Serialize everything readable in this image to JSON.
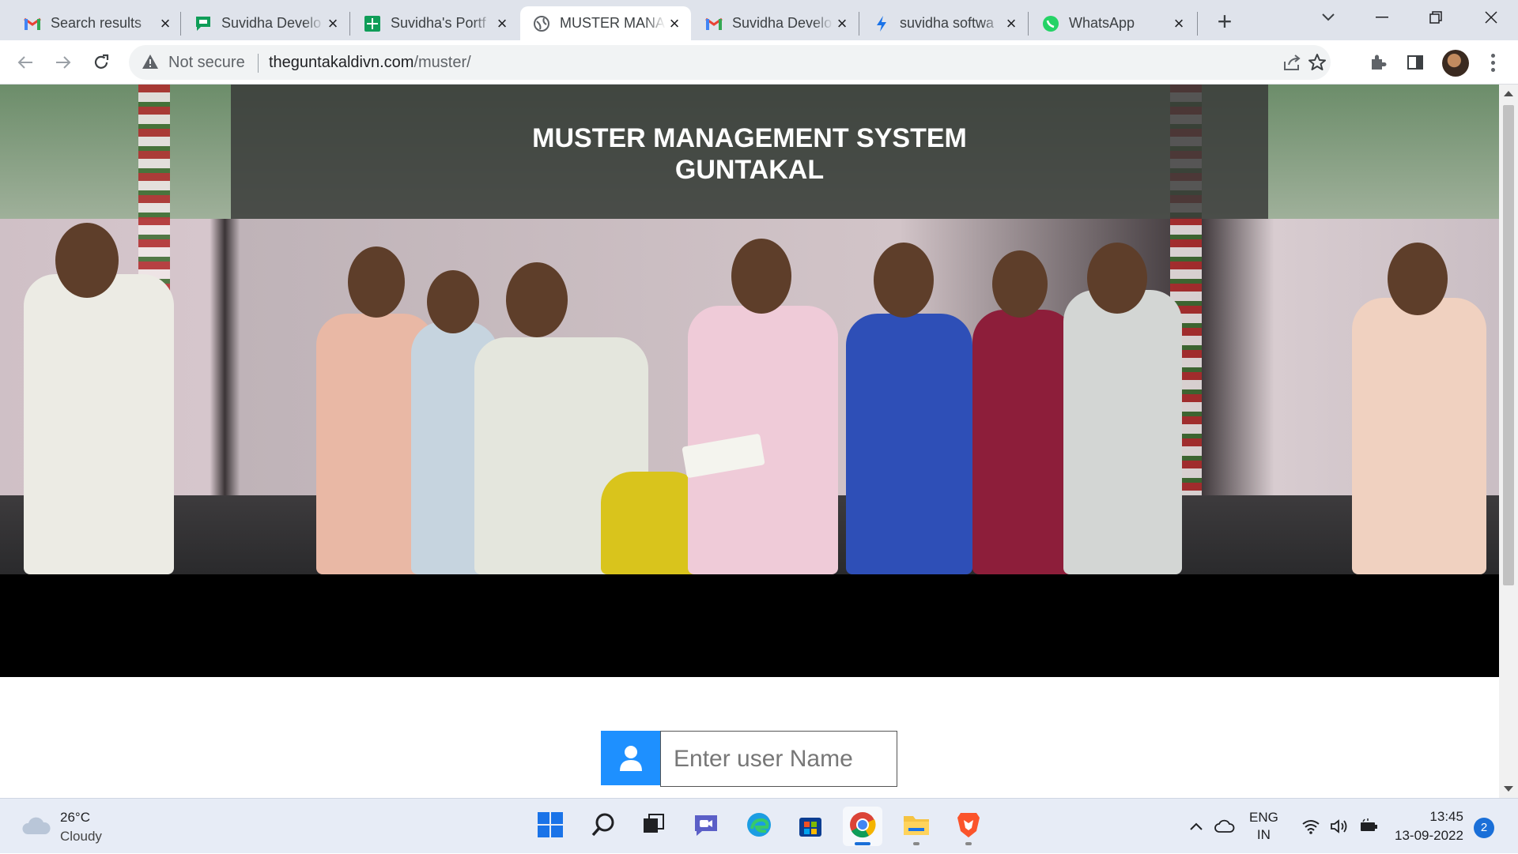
{
  "browser": {
    "tabs": [
      {
        "title": "Search results",
        "icon": "gmail-icon",
        "active": false
      },
      {
        "title": "Suvidha Develo",
        "icon": "google-chat-icon",
        "active": false
      },
      {
        "title": "Suvidha's Portf",
        "icon": "google-sheets-icon",
        "active": false
      },
      {
        "title": "MUSTER MANA",
        "icon": "globe-icon",
        "active": true
      },
      {
        "title": "Suvidha Develo",
        "icon": "gmail-icon",
        "active": false
      },
      {
        "title": "suvidha softwa",
        "icon": "bolt-icon",
        "active": false
      },
      {
        "title": "WhatsApp",
        "icon": "whatsapp-icon",
        "active": false
      }
    ],
    "security_label": "Not secure",
    "url_domain": "theguntakaldivn.com",
    "url_path": "/muster/"
  },
  "page": {
    "title_line1": "MUSTER MANAGEMENT SYSTEM",
    "title_line2": "GUNTAKAL",
    "slide_count": 7,
    "active_slide": 1,
    "username_placeholder": "Enter user Name",
    "accent_color": "#1e90ff",
    "active_dot_color": "#7dbb3a"
  },
  "taskbar": {
    "temperature": "26°C",
    "weather": "Cloudy",
    "lang_line1": "ENG",
    "lang_line2": "IN",
    "time": "13:45",
    "date": "13-09-2022",
    "notification_count": "2",
    "apps": [
      "start-icon",
      "search-icon",
      "task-view-icon",
      "teams-chat-icon",
      "edge-icon",
      "store-icon",
      "chrome-icon",
      "file-explorer-icon",
      "brave-icon"
    ]
  }
}
